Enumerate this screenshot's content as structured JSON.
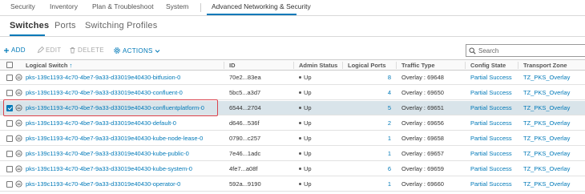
{
  "top_nav": {
    "items": [
      "Security",
      "Inventory",
      "Plan & Troubleshoot",
      "System",
      "Advanced Networking & Security"
    ],
    "active_index": 4
  },
  "sub_tabs": {
    "items": [
      "Switches",
      "Ports",
      "Switching Profiles"
    ],
    "active_index": 0
  },
  "toolbar": {
    "add_label": "ADD",
    "edit_label": "EDIT",
    "delete_label": "DELETE",
    "actions_label": "ACTIONS"
  },
  "search": {
    "placeholder": "Search",
    "value": ""
  },
  "table": {
    "columns": {
      "logical_switch": "Logical Switch",
      "id": "ID",
      "admin_status": "Admin Status",
      "logical_ports": "Logical Ports",
      "traffic_type": "Traffic Type",
      "config_state": "Config State",
      "transport_zone": "Transport Zone"
    },
    "rows": [
      {
        "name": "pks-139c1193-4c70-4be7-9a33-d33019e40430-bitfusion-0",
        "id": "70e2...83ea",
        "admin_status": "Up",
        "logical_ports": "8",
        "traffic_type": "Overlay : 69648",
        "config_state": "Partial Success",
        "transport_zone": "TZ_PKS_Overlay",
        "selected": false
      },
      {
        "name": "pks-139c1193-4c70-4be7-9a33-d33019e40430-confluent-0",
        "id": "5bc5...a3d7",
        "admin_status": "Up",
        "logical_ports": "4",
        "traffic_type": "Overlay : 69650",
        "config_state": "Partial Success",
        "transport_zone": "TZ_PKS_Overlay",
        "selected": false
      },
      {
        "name": "pks-139c1193-4c70-4be7-9a33-d33019e40430-confluentplatform-0",
        "id": "6544...2704",
        "admin_status": "Up",
        "logical_ports": "5",
        "traffic_type": "Overlay : 69651",
        "config_state": "Partial Success",
        "transport_zone": "TZ_PKS_Overlay",
        "selected": true
      },
      {
        "name": "pks-139c1193-4c70-4be7-9a33-d33019e40430-default-0",
        "id": "d646...536f",
        "admin_status": "Up",
        "logical_ports": "2",
        "traffic_type": "Overlay : 69656",
        "config_state": "Partial Success",
        "transport_zone": "TZ_PKS_Overlay",
        "selected": false
      },
      {
        "name": "pks-139c1193-4c70-4be7-9a33-d33019e40430-kube-node-lease-0",
        "id": "0790...c257",
        "admin_status": "Up",
        "logical_ports": "1",
        "traffic_type": "Overlay : 69658",
        "config_state": "Partial Success",
        "transport_zone": "TZ_PKS_Overlay",
        "selected": false
      },
      {
        "name": "pks-139c1193-4c70-4be7-9a33-d33019e40430-kube-public-0",
        "id": "7e46...1adc",
        "admin_status": "Up",
        "logical_ports": "1",
        "traffic_type": "Overlay : 69657",
        "config_state": "Partial Success",
        "transport_zone": "TZ_PKS_Overlay",
        "selected": false
      },
      {
        "name": "pks-139c1193-4c70-4be7-9a33-d33019e40430-kube-system-0",
        "id": "4fe7...a08f",
        "admin_status": "Up",
        "logical_ports": "6",
        "traffic_type": "Overlay : 69659",
        "config_state": "Partial Success",
        "transport_zone": "TZ_PKS_Overlay",
        "selected": false
      },
      {
        "name": "pks-139c1193-4c70-4be7-9a33-d33019e40430-operator-0",
        "id": "592a...9190",
        "admin_status": "Up",
        "logical_ports": "1",
        "traffic_type": "Overlay : 69660",
        "config_state": "Partial Success",
        "transport_zone": "TZ_PKS_Overlay",
        "selected": false
      }
    ]
  },
  "colors": {
    "accent": "#0079b8",
    "selected_row": "#d9e4ea",
    "highlight": "#d9434e"
  },
  "icons": [
    "plus-icon",
    "pencil-icon",
    "trash-icon",
    "gear-icon",
    "chevron-down-icon",
    "search-icon",
    "sort-arrow-icon",
    "logical-switch-icon",
    "status-dot-icon"
  ]
}
